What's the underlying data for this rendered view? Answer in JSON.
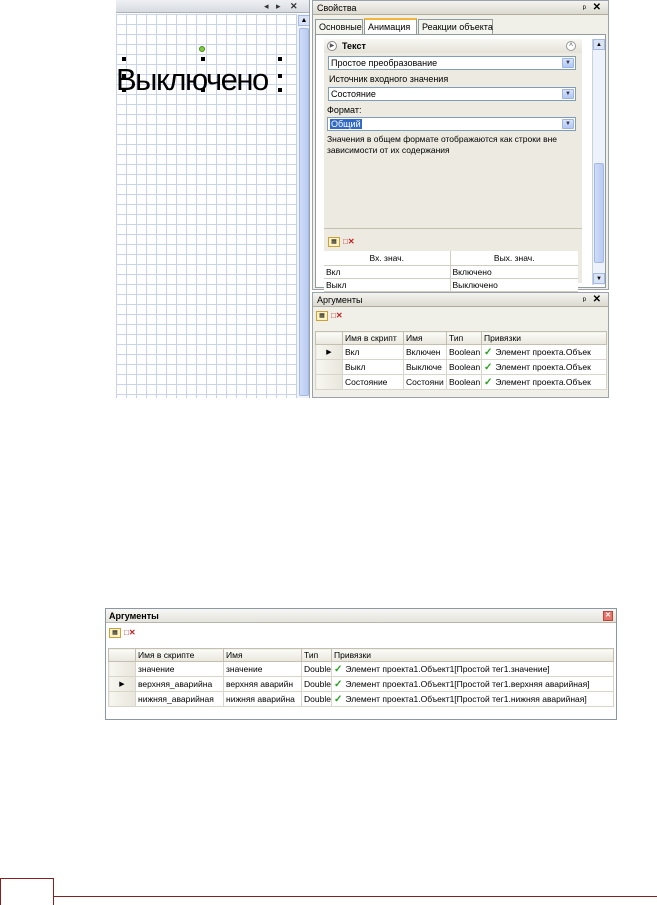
{
  "designer": {
    "header_controls": [
      "◂",
      "▸",
      "✕"
    ],
    "display_text": "Выключено"
  },
  "properties": {
    "title": "Свойства",
    "tabs": [
      {
        "label": "Основные",
        "active": false
      },
      {
        "label": "Анимация",
        "active": true
      },
      {
        "label": "Реакции объекта",
        "active": false
      }
    ],
    "group_title": "Текст",
    "transform_value": "Простое преобразование",
    "source_label": "Источник входного значения",
    "source_value": "Состояние",
    "format_label": "Формат:",
    "format_value": "Общий",
    "description": "Значения в общем формате отображаются как строки вне зависимости от их содержания",
    "mapping_columns": [
      "Вх. знач.",
      "Вых. знач."
    ],
    "mapping_rows": [
      {
        "in": "Вкл",
        "out": "Включено"
      },
      {
        "in": "Выкл",
        "out": "Выключено"
      }
    ]
  },
  "args_top": {
    "title": "Аргументы",
    "columns": [
      "Имя в скрипт",
      "Имя",
      "Тип",
      "Привязки"
    ],
    "rows": [
      {
        "marker": "▶",
        "script_name": "Вкл",
        "name": "Включен",
        "type": "Boolean",
        "binding": "Элемент проекта.Объек"
      },
      {
        "marker": "",
        "script_name": "Выкл",
        "name": "Выключе",
        "type": "Boolean",
        "binding": "Элемент проекта.Объек"
      },
      {
        "marker": "",
        "script_name": "Состояние",
        "name": "Состояни",
        "type": "Boolean",
        "binding": "Элемент проекта.Объек"
      }
    ]
  },
  "args_bottom": {
    "title": "Аргументы",
    "columns": [
      "Имя в скрипте",
      "Имя",
      "Тип",
      "Привязки"
    ],
    "rows": [
      {
        "marker": "",
        "script_name": "значение",
        "name": "значение",
        "type": "Double",
        "binding": "Элемент проекта1.Объект1[Простой тег1.значение]"
      },
      {
        "marker": "▶",
        "script_name": "верхняя_аварийна",
        "name": "верхняя аварийн",
        "type": "Double",
        "binding": "Элемент проекта1.Объект1[Простой тег1.верхняя аварийная]"
      },
      {
        "marker": "",
        "script_name": "нижняя_аварийная",
        "name": "нижняя аварийна",
        "type": "Double",
        "binding": "Элемент проекта1.Объект1[Простой тег1.нижняя аварийная]"
      }
    ]
  },
  "colors": {
    "accent_line": "#8a1e1e",
    "tab_highlight": "#f3b63a",
    "selection": "#316ac5",
    "check": "#27a11e"
  }
}
